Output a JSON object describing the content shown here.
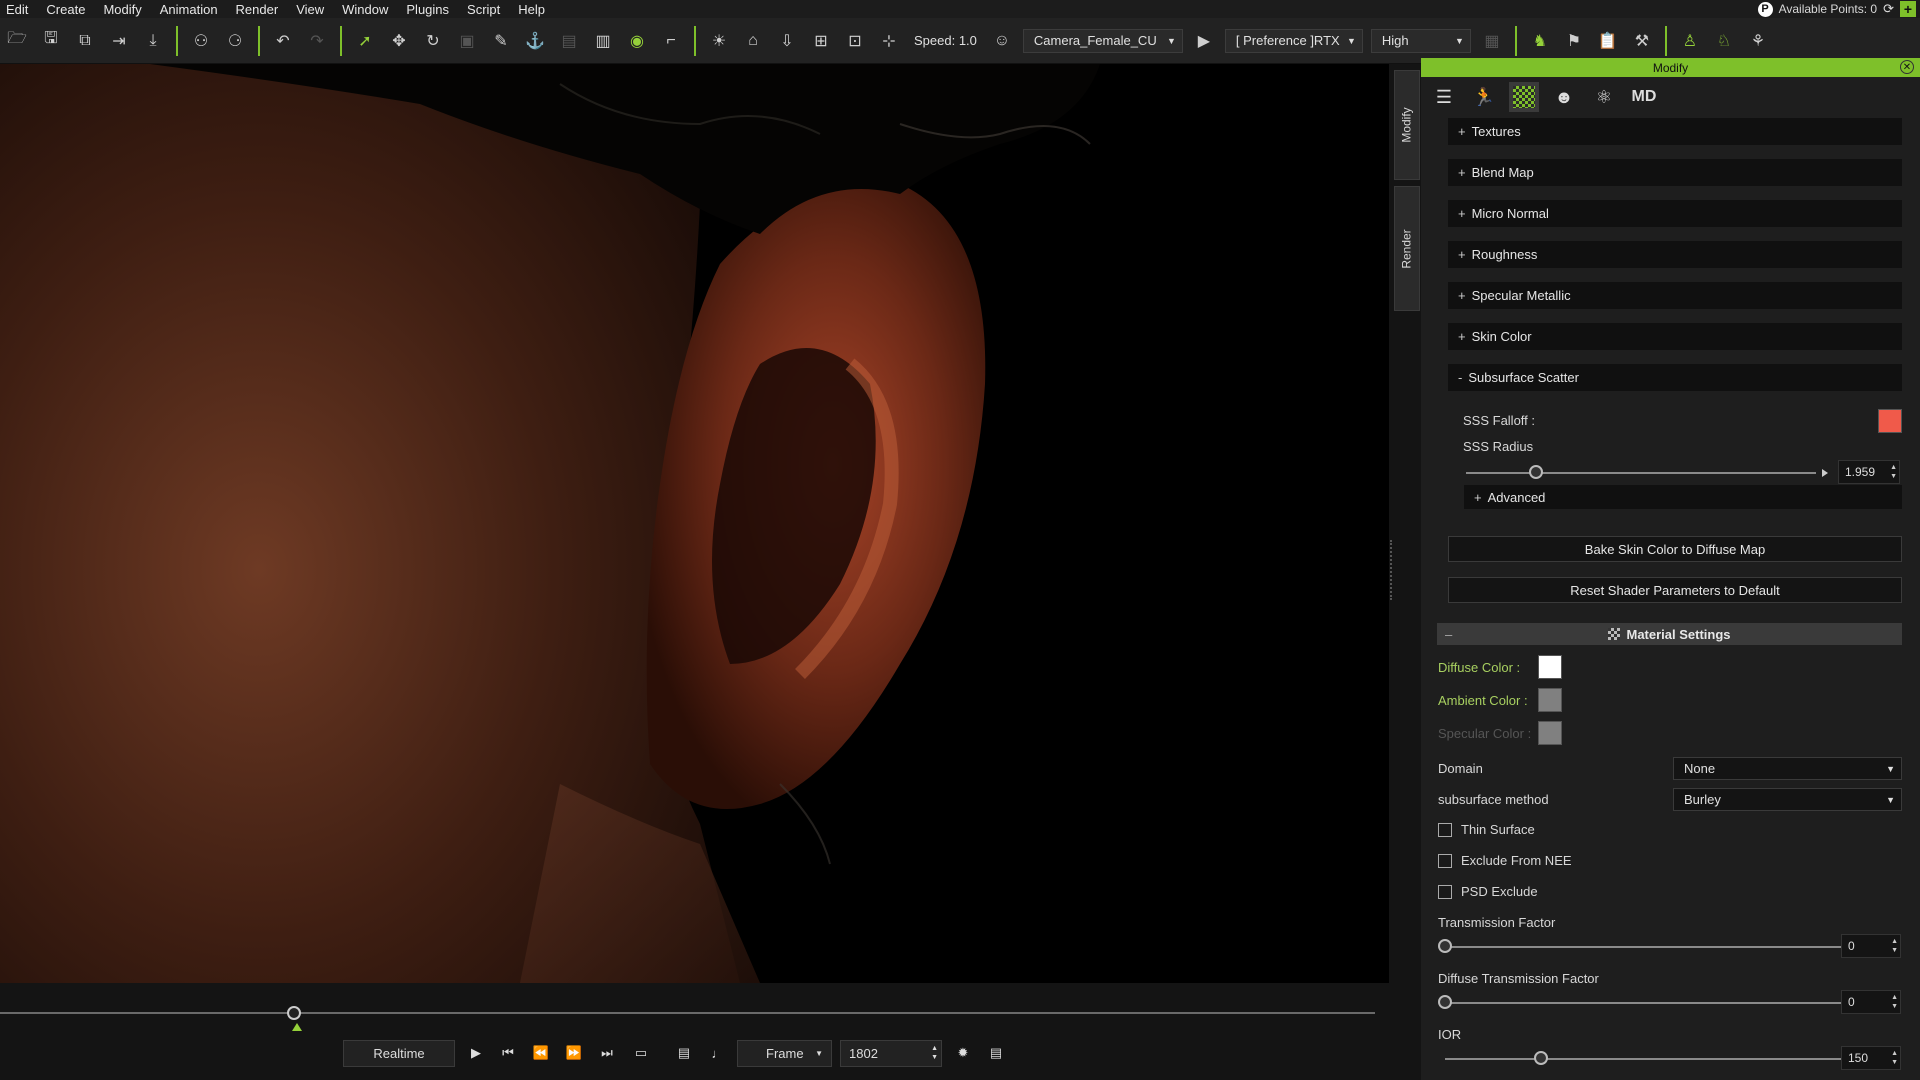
{
  "menu": [
    "Edit",
    "Create",
    "Modify",
    "Animation",
    "Render",
    "View",
    "Window",
    "Plugins",
    "Script",
    "Help"
  ],
  "account": {
    "points_label": "Available Points: 0",
    "p_badge": "P"
  },
  "toolbar": {
    "speed_label": "Speed: 1.0",
    "camera_select": "Camera_Female_CU",
    "preference_select": "[ Preference ]RTX",
    "quality_select": "High"
  },
  "side_tabs": {
    "modify": "Modify",
    "render": "Render"
  },
  "panel": {
    "title": "Modify",
    "tab_md_label": "MD",
    "sections": [
      "Textures",
      "Blend Map",
      "Micro Normal",
      "Roughness",
      "Specular Metallic",
      "Skin Color"
    ],
    "subsurface": {
      "title": "Subsurface Scatter",
      "falloff_label": "SSS Falloff :",
      "falloff_color": "#f05a4a",
      "radius_label": "SSS Radius",
      "radius_value": "1.959",
      "radius_fraction": 0.2,
      "advanced_label": "Advanced"
    },
    "buttons": {
      "bake": "Bake Skin Color to Diffuse Map",
      "reset": "Reset Shader Parameters to Default"
    },
    "material": {
      "title": "Material Settings",
      "diffuse_label": "Diffuse Color :",
      "diffuse_color": "#ffffff",
      "ambient_label": "Ambient Color :",
      "ambient_color": "#808080",
      "specular_label": "Specular Color :",
      "specular_color": "#808080",
      "domain_label": "Domain",
      "domain_value": "None",
      "subsurface_method_label": "subsurface method",
      "subsurface_method_value": "Burley",
      "thin_surface_label": "Thin Surface",
      "exclude_nee_label": "Exclude From NEE",
      "psd_exclude_label": "PSD Exclude",
      "transmission_label": "Transmission Factor",
      "transmission_value": "0",
      "diffuse_transmission_label": "Diffuse Transmission Factor",
      "diffuse_transmission_value": "0",
      "ior_label": "IOR",
      "ior_value": "150"
    }
  },
  "timeline": {
    "realtime_label": "Realtime",
    "frame_mode": "Frame",
    "frame_value": "1802"
  }
}
